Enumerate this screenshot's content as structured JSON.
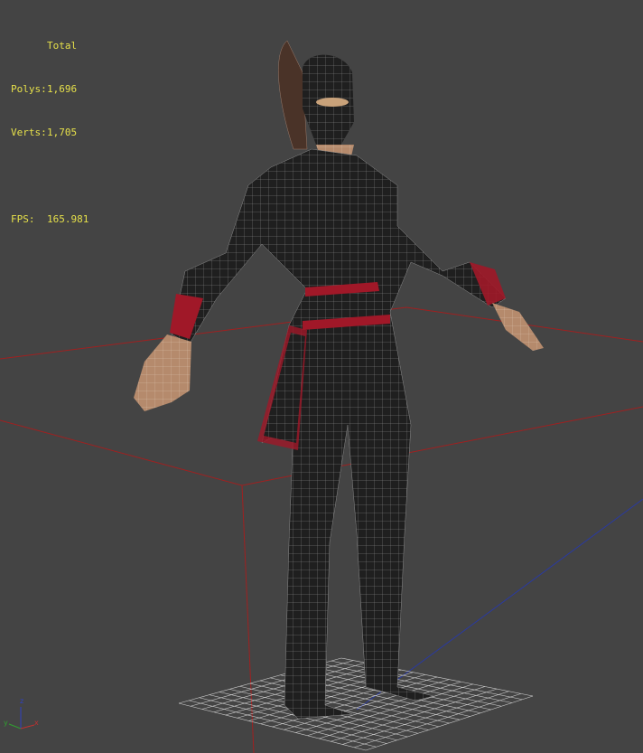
{
  "stats": {
    "header": "Total",
    "polys_label": "Polys:",
    "polys_value": "1,696",
    "verts_label": "Verts:",
    "verts_value": "1,705",
    "fps_label": "FPS:",
    "fps_value": "165.981"
  },
  "gizmo": {
    "x": "x",
    "y": "y",
    "z": "z"
  },
  "colors": {
    "background": "#444444",
    "stats_text": "#e6e04a",
    "bounding_box": "#a02020",
    "axis_blue": "#2a3aa0",
    "body": "#1e1e1e",
    "accent_red": "#a01828"
  }
}
